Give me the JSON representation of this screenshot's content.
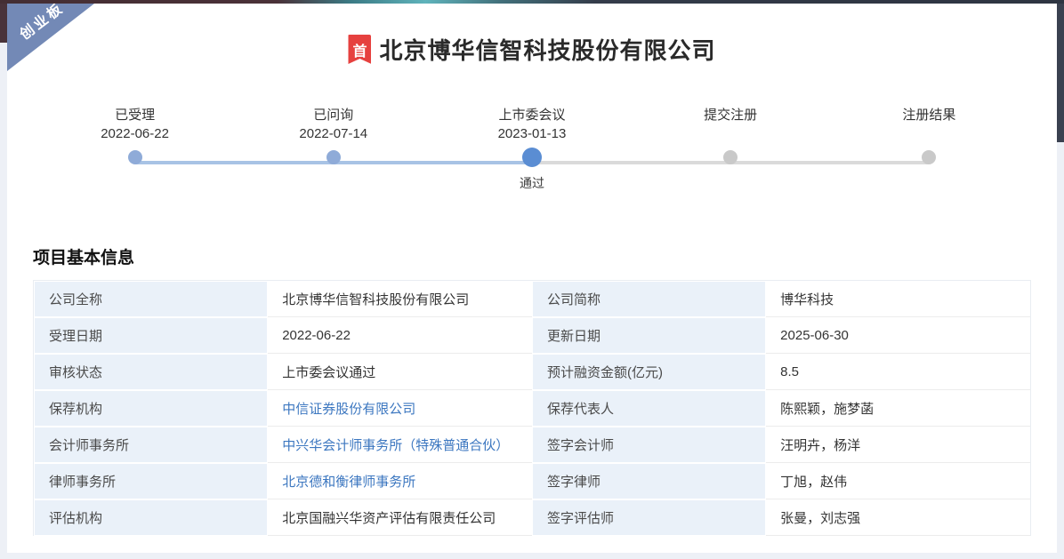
{
  "page": {
    "board_ribbon": "创业板",
    "title_badge": "首",
    "company_title": "北京博华信智科技股份有限公司"
  },
  "timeline": {
    "steps": [
      {
        "name": "已受理",
        "date": "2022-06-22",
        "state": "done",
        "note": ""
      },
      {
        "name": "已问询",
        "date": "2022-07-14",
        "state": "done",
        "note": ""
      },
      {
        "name": "上市委会议",
        "date": "2023-01-13",
        "state": "active",
        "note": "通过"
      },
      {
        "name": "提交注册",
        "date": "",
        "state": "pending",
        "note": ""
      },
      {
        "name": "注册结果",
        "date": "",
        "state": "pending",
        "note": ""
      }
    ]
  },
  "section": {
    "title": "项目基本信息"
  },
  "info_table": {
    "rows": [
      [
        {
          "label": "公司全称",
          "value": "北京博华信智科技股份有限公司",
          "link": false
        },
        {
          "label": "公司简称",
          "value": "博华科技",
          "link": false
        }
      ],
      [
        {
          "label": "受理日期",
          "value": "2022-06-22",
          "link": false
        },
        {
          "label": "更新日期",
          "value": "2025-06-30",
          "link": false
        }
      ],
      [
        {
          "label": "审核状态",
          "value": "上市委会议通过",
          "link": false
        },
        {
          "label": "预计融资金额(亿元)",
          "value": "8.5",
          "link": false
        }
      ],
      [
        {
          "label": "保荐机构",
          "value": "中信证券股份有限公司",
          "link": true
        },
        {
          "label": "保荐代表人",
          "value": "陈熙颖，施梦菡",
          "link": false
        }
      ],
      [
        {
          "label": "会计师事务所",
          "value": "中兴华会计师事务所（特殊普通合伙）",
          "link": true
        },
        {
          "label": "签字会计师",
          "value": "汪明卉，杨洋",
          "link": false
        }
      ],
      [
        {
          "label": "律师事务所",
          "value": "北京德和衡律师事务所",
          "link": true
        },
        {
          "label": "签字律师",
          "value": "丁旭，赵伟",
          "link": false
        }
      ],
      [
        {
          "label": "评估机构",
          "value": "北京国融兴华资产评估有限责任公司",
          "link": false
        },
        {
          "label": "签字评估师",
          "value": "张曼，刘志强",
          "link": false
        }
      ]
    ]
  },
  "colors": {
    "ribbon_blue": "#7389b6",
    "badge_red": "#e6413f",
    "dot_done": "#8fabd8",
    "dot_active": "#5a8dd3",
    "dot_pending": "#c9c9c9",
    "line_done": "#a8c3e5",
    "line_pending": "#dadada",
    "label_cell_bg": "#eaf1f9",
    "link_blue": "#3c77c0"
  }
}
